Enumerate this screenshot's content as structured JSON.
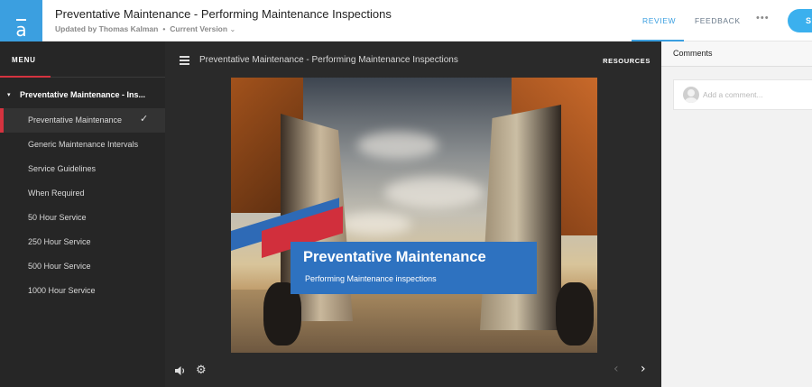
{
  "app": {
    "logo_letter": "a"
  },
  "header": {
    "title": "Preventative Maintenance - Performing Maintenance Inspections",
    "updated_by": "Updated by Thomas Kalman",
    "separator": "•",
    "version": "Current Version",
    "version_chevron": "⌄",
    "tabs": [
      {
        "label": "REVIEW",
        "active": true
      },
      {
        "label": "FEEDBACK",
        "active": false
      }
    ],
    "more": "•••",
    "share_label": "S"
  },
  "menu": {
    "label": "MENU",
    "section": {
      "caret": "▾",
      "title": "Preventative Maintenance - Ins..."
    },
    "items": [
      {
        "label": "Preventative Maintenance",
        "active": true,
        "check": "✓"
      },
      {
        "label": "Generic Maintenance Intervals"
      },
      {
        "label": "Service Guidelines"
      },
      {
        "label": "When Required"
      },
      {
        "label": "50 Hour Service"
      },
      {
        "label": "250 Hour Service"
      },
      {
        "label": "500 Hour Service"
      },
      {
        "label": "1000 Hour Service"
      }
    ]
  },
  "player": {
    "title": "Preventative Maintenance - Performing Maintenance Inspections",
    "resources_label": "RESOURCES",
    "slide": {
      "heading": "Preventative Maintenance",
      "subheading": "Performing Maintenance inspections"
    },
    "controls": {
      "settings_glyph": "⚙",
      "prev_glyph": "‹",
      "next_glyph": "›"
    }
  },
  "comments": {
    "title": "Comments",
    "placeholder": "Add a comment..."
  },
  "colors": {
    "accent": "#3b9fe0",
    "menu_active": "#d5333f",
    "banner": "#2e72c0"
  }
}
